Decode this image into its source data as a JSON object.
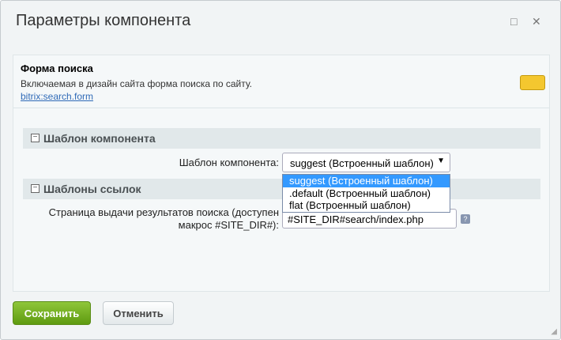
{
  "window": {
    "title": "Параметры компонента",
    "maximize_icon": "□",
    "close_icon": "✕"
  },
  "component": {
    "name": "Форма поиска",
    "description": "Включаемая в дизайн сайта форма поиска по сайту.",
    "code": "bitrix:search.form"
  },
  "sections": [
    {
      "title": "Шаблон компонента",
      "toggle": "−",
      "field_label": "Шаблон компонента:",
      "value": "suggest (Встроенный шаблон)",
      "options": [
        "suggest (Встроенный шаблон)",
        ".default (Встроенный шаблон)",
        "flat (Встроенный шаблон)"
      ]
    },
    {
      "title": "Шаблоны ссылок",
      "toggle": "−",
      "field_label_1": "Страница выдачи результатов поиска (доступен",
      "field_label_2": "макрос #SITE_DIR#):",
      "value": "#SITE_DIR#search/index.php",
      "help": "?"
    }
  ],
  "buttons": {
    "save": "Сохранить",
    "cancel": "Отменить"
  }
}
